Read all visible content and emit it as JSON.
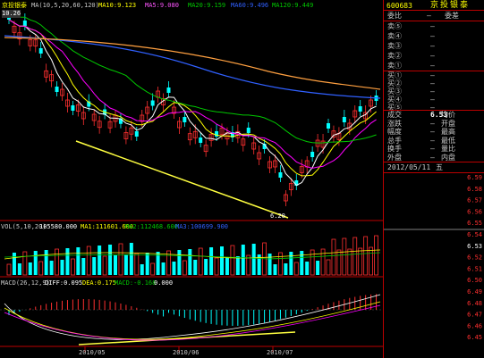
{
  "header": {
    "stock_name": "京投银泰",
    "ma_label": "MA(10,5,20,60,120)",
    "ma10": "MA10:9.123",
    "ma5": "MA5:9.080",
    "ma20": "MA20:9.159",
    "ma60": "MA60:9.496",
    "ma120": "MA120:9.449",
    "high_mark": "10.26"
  },
  "vol_header": {
    "label": "VOL(5,10,20)",
    "value": "105580.000",
    "ma1": "MA1:111601.600",
    "ma2": "MA2:112468.600",
    "ma3": "MA3:100699.900"
  },
  "macd_header": {
    "label": "MACD(26,12,9)",
    "diff": "DIFF:0.095",
    "dea": "DEA:0.175",
    "macd": "MACD:-0.168",
    "extra": "0.000"
  },
  "low_mark": "6.20",
  "x_axis": {
    "d1": "2010/05",
    "d2": "2010/06",
    "d3": "2010/07"
  },
  "panel": {
    "code": "600683",
    "name": "京投银泰",
    "weibi_k": "委比",
    "weibi_v": "—",
    "weicha_k": "委差",
    "weicha_v": "—",
    "sell": [
      {
        "k": "卖⑤",
        "v": "—"
      },
      {
        "k": "卖④",
        "v": "—"
      },
      {
        "k": "卖③",
        "v": "—"
      },
      {
        "k": "卖②",
        "v": "—"
      },
      {
        "k": "卖①",
        "v": "—"
      }
    ],
    "buy": [
      {
        "k": "买①",
        "v": "—"
      },
      {
        "k": "买②",
        "v": "—"
      },
      {
        "k": "买③",
        "v": "—"
      },
      {
        "k": "买④",
        "v": "—"
      },
      {
        "k": "买⑤",
        "v": "—"
      }
    ],
    "quote": [
      {
        "k": "成交",
        "v": "6.53",
        "k2": "均价",
        "v2": ""
      },
      {
        "k": "涨跌",
        "v": "—",
        "k2": "开盘",
        "v2": ""
      },
      {
        "k": "幅度",
        "v": "—",
        "k2": "最高",
        "v2": ""
      },
      {
        "k": "总手",
        "v": "—",
        "k2": "最低",
        "v2": ""
      },
      {
        "k": "换手",
        "v": "—",
        "k2": "量比",
        "v2": ""
      },
      {
        "k": "外盘",
        "v": "—",
        "k2": "内盘",
        "v2": ""
      }
    ],
    "datetime": "2012/05/11",
    "weekday": "五",
    "yticks": [
      "6.59",
      "6.58",
      "6.57",
      "6.56",
      "6.55",
      "6.54",
      "6.53",
      "6.52",
      "6.51",
      "6.50",
      "6.49",
      "6.48",
      "6.47",
      "6.46",
      "6.45"
    ]
  },
  "colors": {
    "up": "#ff3030",
    "down": "#00ffff",
    "ma5": "#ffffff",
    "ma10": "#ffff00",
    "ma20": "#ff00ff",
    "ma60": "#00c800",
    "ma120": "#ffa040",
    "ma_blue": "#3060ff",
    "trend": "#ffff40",
    "accent": "#ff3030"
  }
}
